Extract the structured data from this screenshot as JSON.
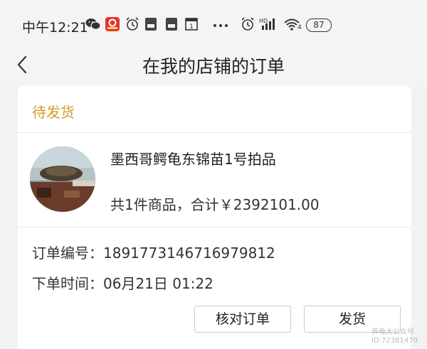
{
  "status_bar": {
    "time": "中午12:21",
    "battery": "87",
    "network": "4"
  },
  "nav": {
    "title": "在我的店铺的订单"
  },
  "order": {
    "status": "待发货",
    "product_name": "墨西哥鳄龟东锦苗1号拍品",
    "summary": "共1件商品，合计￥2392101.00",
    "number_label": "订单编号：",
    "number": "1891773146716979812",
    "time_label": "下单时间：",
    "time": "06月21日 01:22"
  },
  "actions": {
    "verify_label": "核对订单",
    "ship_label": "发货"
  },
  "watermark": {
    "line1": "养龟大公众号",
    "line2": "ID:72381470"
  },
  "colors": {
    "status_accent": "#d99a2b",
    "card_bg": "#ffffff",
    "page_bg": "#f2f2f2"
  }
}
